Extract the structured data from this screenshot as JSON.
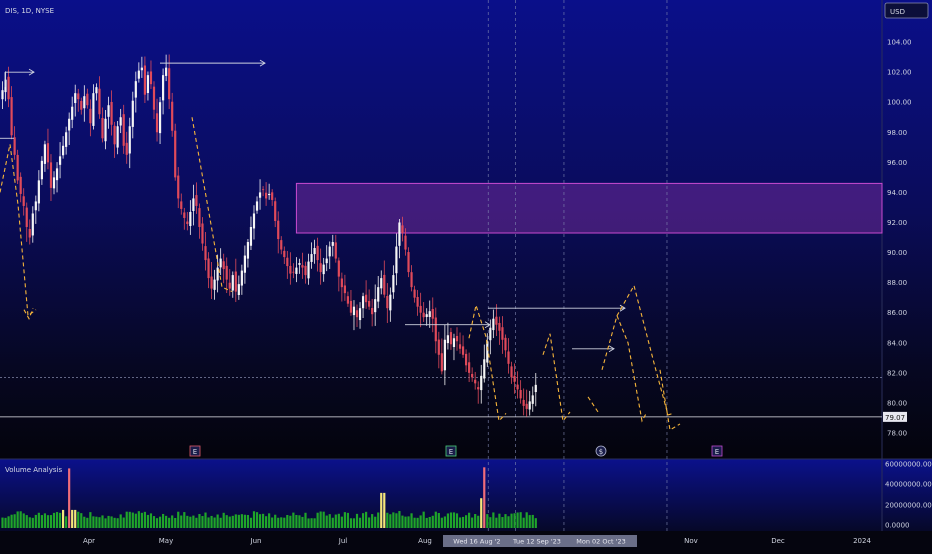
{
  "header": {
    "symbol": "DIS, 1D, NYSE",
    "currency_button": "USD"
  },
  "volume_title": "Volume Analysis",
  "colors": {
    "up": "#f5f5f5",
    "down": "#e04a5a",
    "vol_normal": "#1fa52a",
    "vol_high": "#f5e67a",
    "vol_climax": "#ef6c7a",
    "zone": "#c94ad0",
    "projection": "#f5b43a",
    "arrow": "#cfd3e0"
  },
  "chart_data": {
    "type": "candlestick",
    "symbol": "DIS",
    "interval": "1D",
    "exchange": "NYSE",
    "currency": "USD",
    "ylim": [
      77,
      106
    ],
    "y_ticks": [
      "104.00",
      "102.00",
      "100.00",
      "98.00",
      "96.00",
      "94.00",
      "92.00",
      "90.00",
      "88.00",
      "86.00",
      "84.00",
      "82.00",
      "80.00",
      "78.00"
    ],
    "price_label": "79.07",
    "price_line": 79.07,
    "dotted_level": 81.7,
    "volume_ticks": [
      "60000000.00",
      "40000000.00",
      "20000000.00",
      "0.0000"
    ],
    "volume_ylim": [
      0,
      62000000
    ],
    "x_ticks": [
      "Apr",
      "May",
      "Jun",
      "Jul",
      "Aug",
      "Sep",
      "Oct",
      "Nov",
      "Dec",
      "2024"
    ],
    "date_badges": [
      "Wed 16 Aug '23",
      "Tue 12 Sep '23",
      "Mon 02 Oct '23"
    ],
    "event_markers": [
      {
        "label": "E",
        "index": 22
      },
      {
        "label": "E",
        "index": 160
      },
      {
        "label": "$",
        "index": 216
      },
      {
        "label": "E",
        "index": 260
      }
    ],
    "supply_zone": {
      "top": 94.6,
      "bottom": 91.3,
      "start_index": 97
    },
    "closes": [
      100.8,
      101.5,
      100.2,
      97.8,
      96.5,
      94.8,
      93.9,
      93.1,
      91.7,
      91.0,
      92.6,
      93.4,
      94.8,
      96.1,
      97.2,
      96.0,
      94.3,
      95.0,
      95.6,
      96.4,
      97.1,
      98.0,
      98.9,
      99.7,
      100.6,
      100.2,
      99.5,
      100.4,
      99.8,
      98.6,
      100.6,
      101.0,
      99.2,
      97.6,
      98.9,
      99.8,
      98.5,
      97.2,
      98.4,
      99.0,
      97.1,
      96.5,
      98.4,
      100.1,
      101.4,
      102.1,
      102.3,
      100.5,
      101.8,
      101.2,
      99.5,
      98.0,
      100.0,
      101.8,
      102.3,
      100.2,
      98.1,
      95.0,
      93.6,
      92.9,
      92.3,
      91.9,
      92.7,
      93.6,
      93.1,
      91.7,
      90.6,
      89.5,
      88.3,
      87.6,
      88.2,
      89.0,
      89.6,
      88.9,
      88.2,
      87.6,
      88.5,
      87.4,
      87.9,
      88.8,
      89.8,
      90.7,
      91.7,
      92.6,
      93.4,
      94.0,
      94.2,
      93.6,
      93.9,
      93.5,
      92.1,
      90.9,
      90.2,
      89.7,
      89.1,
      88.6,
      88.7,
      89.0,
      89.3,
      89.0,
      88.5,
      89.4,
      89.9,
      90.3,
      89.5,
      88.7,
      89.2,
      89.6,
      90.4,
      90.7,
      89.6,
      88.4,
      87.7,
      87.3,
      86.6,
      86.0,
      86.4,
      85.7,
      86.3,
      87.1,
      86.7,
      86.4,
      85.9,
      86.9,
      87.7,
      88.3,
      87.2,
      86.3,
      87.2,
      88.5,
      90.4,
      92.0,
      91.3,
      90.2,
      88.7,
      87.7,
      87.0,
      86.4,
      86.0,
      85.7,
      85.9,
      86.1,
      85.6,
      84.1,
      83.2,
      82.1,
      84.2,
      84.5,
      83.9,
      84.3,
      84.1,
      83.6,
      83.2,
      82.5,
      82.0,
      81.7,
      81.3,
      80.9,
      81.8,
      82.9,
      84.1,
      85.0,
      85.6,
      85.2,
      84.8,
      84.2,
      83.5,
      82.6,
      81.7,
      81.4,
      80.9,
      80.3,
      79.8,
      79.6,
      80.1,
      80.5,
      81.2
    ]
  }
}
